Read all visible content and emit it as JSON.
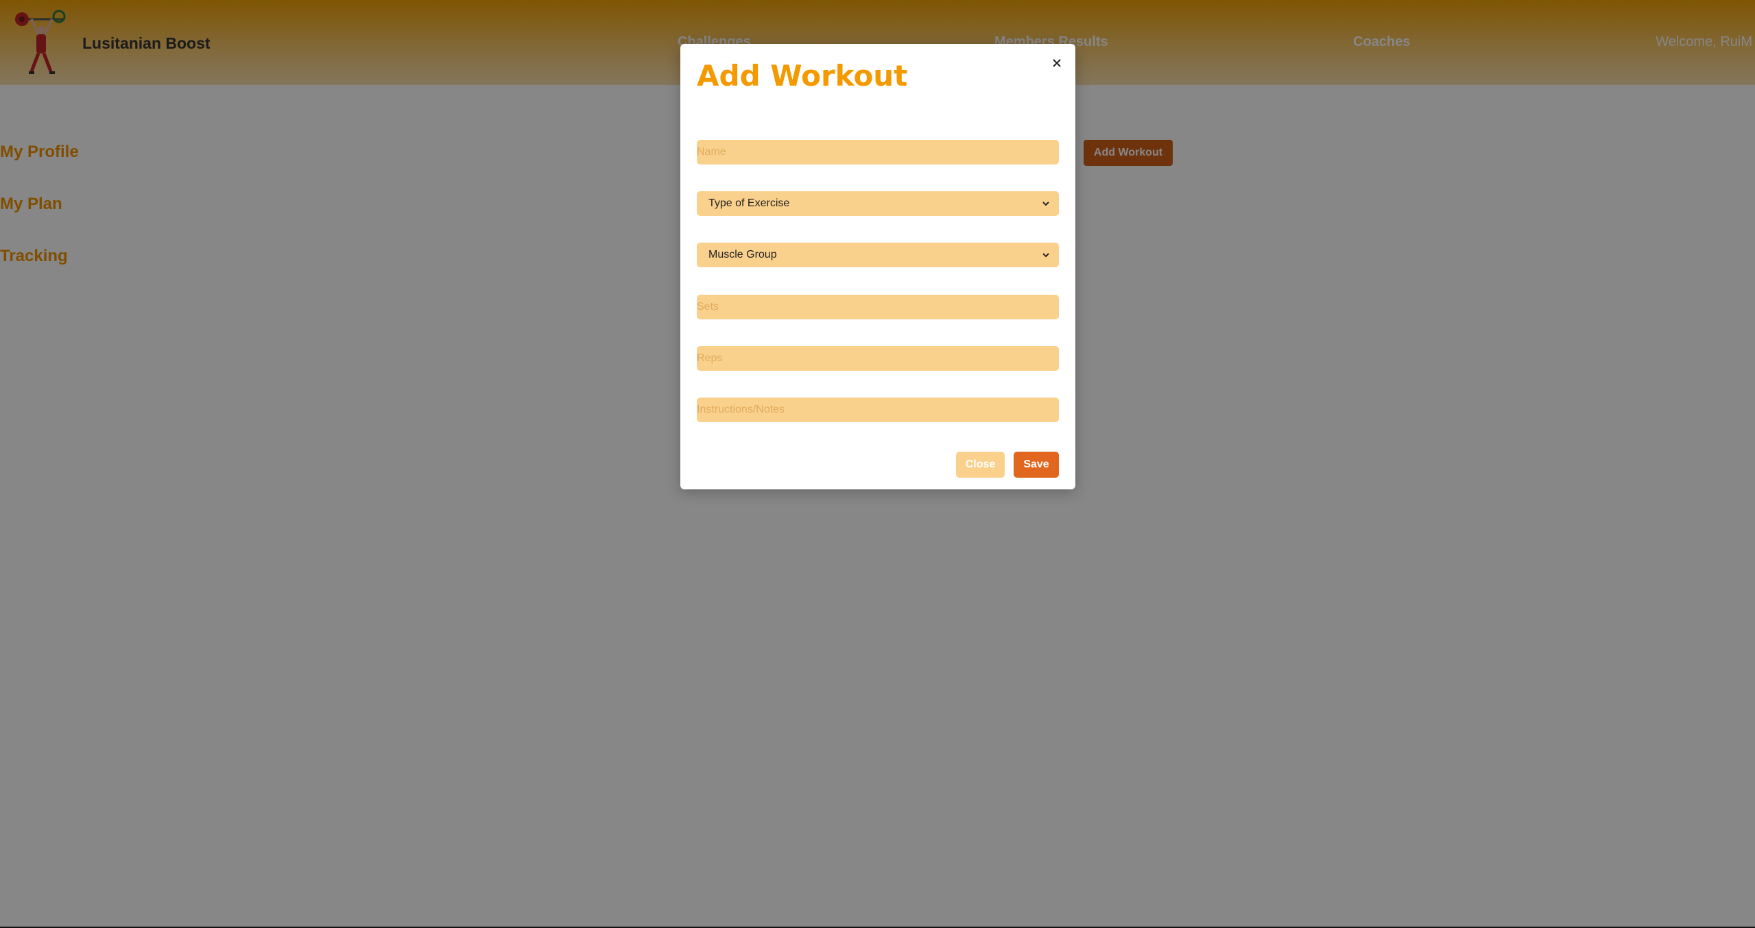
{
  "header": {
    "brand": "Lusitanian Boost",
    "nav": {
      "challenges": "Challenges",
      "members_results": "Members Results",
      "coaches": "Coaches"
    },
    "welcome": "Welcome, RuiM"
  },
  "sidebar": {
    "items": [
      {
        "label": "My Profile"
      },
      {
        "label": "My Plan"
      },
      {
        "label": "Tracking"
      }
    ]
  },
  "main": {
    "add_workout_label": "Add Workout"
  },
  "modal": {
    "title": "Add Workout",
    "fields": {
      "name_placeholder": "Name",
      "type_of_exercise": "Type of Exercise",
      "muscle_group": "Muscle Group",
      "sets_placeholder": "Sets",
      "reps_placeholder": "Reps",
      "notes_placeholder": "Instructions/Notes"
    },
    "close_label": "Close",
    "save_label": "Save"
  },
  "colors": {
    "accent": "#f49a00",
    "field_bg": "#fad18c",
    "save_bg": "#e0671d",
    "add_workout_bg": "#d06019"
  }
}
